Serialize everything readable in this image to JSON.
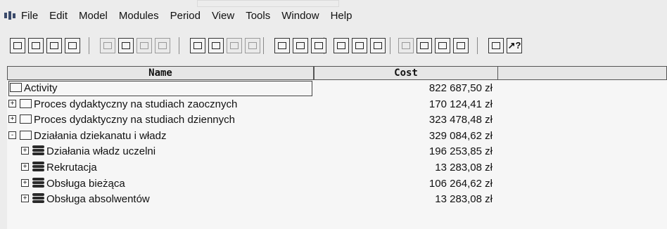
{
  "menu": [
    "File",
    "Edit",
    "Model",
    "Modules",
    "Period",
    "View",
    "Tools",
    "Window",
    "Help"
  ],
  "toolbar": {
    "icons": [
      "new-icon",
      "open-icon",
      "save-icon",
      "print-icon",
      "cut-icon",
      "copy-icon",
      "paste-icon",
      "undo-icon",
      "new-object-icon",
      "delete-object-icon",
      "move-icon",
      "properties-icon",
      "collapse-icon",
      "expand-all-icon",
      "tree-icon",
      "view-a-icon",
      "view-b-icon",
      "view-c-icon",
      "filter-icon",
      "nav-a-icon",
      "nav-b-icon",
      "nav-c-icon",
      "options-icon",
      "help-pointer-icon"
    ]
  },
  "grid": {
    "columns": [
      "Name",
      "Cost"
    ],
    "rows": [
      {
        "name": "Activity",
        "cost": "822 687,50 zł",
        "level": 0,
        "icon": "folder",
        "expand": ""
      },
      {
        "name": "Proces dydaktyczny na studiach zaocznych",
        "cost": "170 124,41 zł",
        "level": 1,
        "icon": "folder",
        "expand": "+"
      },
      {
        "name": "Proces dydaktyczny na studiach dziennych",
        "cost": "323 478,48 zł",
        "level": 1,
        "icon": "folder",
        "expand": "+"
      },
      {
        "name": "Działania dziekanatu i władz",
        "cost": "329 084,62 zł",
        "level": 1,
        "icon": "folder",
        "expand": "-"
      },
      {
        "name": "Działania władz uczelni",
        "cost": "196 253,85 zł",
        "level": 2,
        "icon": "stack",
        "expand": "+"
      },
      {
        "name": "Rekrutacja",
        "cost": "13 283,08 zł",
        "level": 2,
        "icon": "stack",
        "expand": "+"
      },
      {
        "name": "Obsługa bieżąca",
        "cost": "106 264,62 zł",
        "level": 2,
        "icon": "stack",
        "expand": "+"
      },
      {
        "name": "Obsługa absolwentów",
        "cost": "13 283,08 zł",
        "level": 2,
        "icon": "stack",
        "expand": "+"
      }
    ]
  }
}
